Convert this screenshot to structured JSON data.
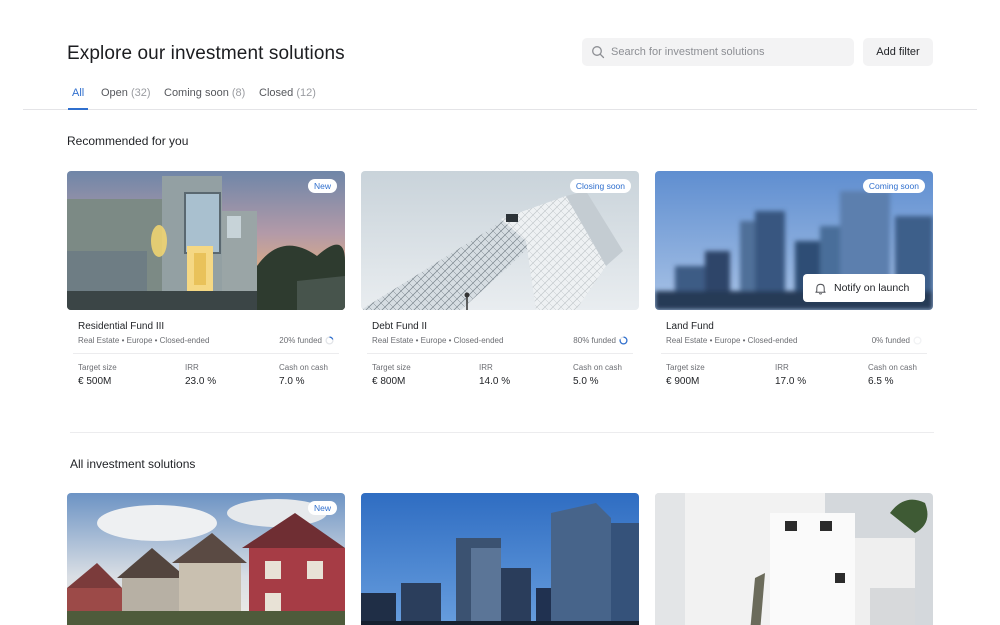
{
  "header": {
    "title": "Explore our investment solutions"
  },
  "search": {
    "placeholder": "Search for investment solutions",
    "value": ""
  },
  "toolbar": {
    "add_filter_label": "Add filter"
  },
  "tabs": [
    {
      "label": "All",
      "count": "",
      "active": true
    },
    {
      "label": "Open",
      "count": "(32)"
    },
    {
      "label": "Coming soon",
      "count": "(8)"
    },
    {
      "label": "Closed",
      "count": "(12)"
    }
  ],
  "recommended": {
    "title": "Recommended for you",
    "metric_labels": {
      "target": "Target size",
      "irr": "IRR",
      "coc": "Cash on cash"
    },
    "cards": [
      {
        "name": "Residential Fund III",
        "meta": "Real Estate • Europe • Closed-ended",
        "funded": "20% funded",
        "funded_fraction": 0.2,
        "badge": "New",
        "target": "€ 500M",
        "irr": "23.0 %",
        "coc": "7.0 %"
      },
      {
        "name": "Debt Fund II",
        "meta": "Real Estate • Europe • Closed-ended",
        "funded": "80% funded",
        "funded_fraction": 0.8,
        "badge": "Closing soon",
        "target": "€ 800M",
        "irr": "14.0 %",
        "coc": "5.0 %"
      },
      {
        "name": "Land Fund",
        "meta": "Real Estate • Europe • Closed-ended",
        "funded": "0% funded",
        "funded_fraction": 0,
        "badge": "Coming soon",
        "notify_label": "Notify on launch",
        "target": "€ 900M",
        "irr": "17.0 %",
        "coc": "6.5 %"
      }
    ]
  },
  "all_solutions": {
    "title": "All investment solutions",
    "cards": [
      {
        "badge": "New"
      },
      {
        "badge": ""
      },
      {
        "badge": ""
      }
    ]
  },
  "colors": {
    "accent": "#2f6fce",
    "surface": "#f3f3f4",
    "divider": "#e4e4e7"
  },
  "icons": {
    "search": "search-icon",
    "bell": "bell-icon",
    "progress": "progress-ring-icon"
  }
}
